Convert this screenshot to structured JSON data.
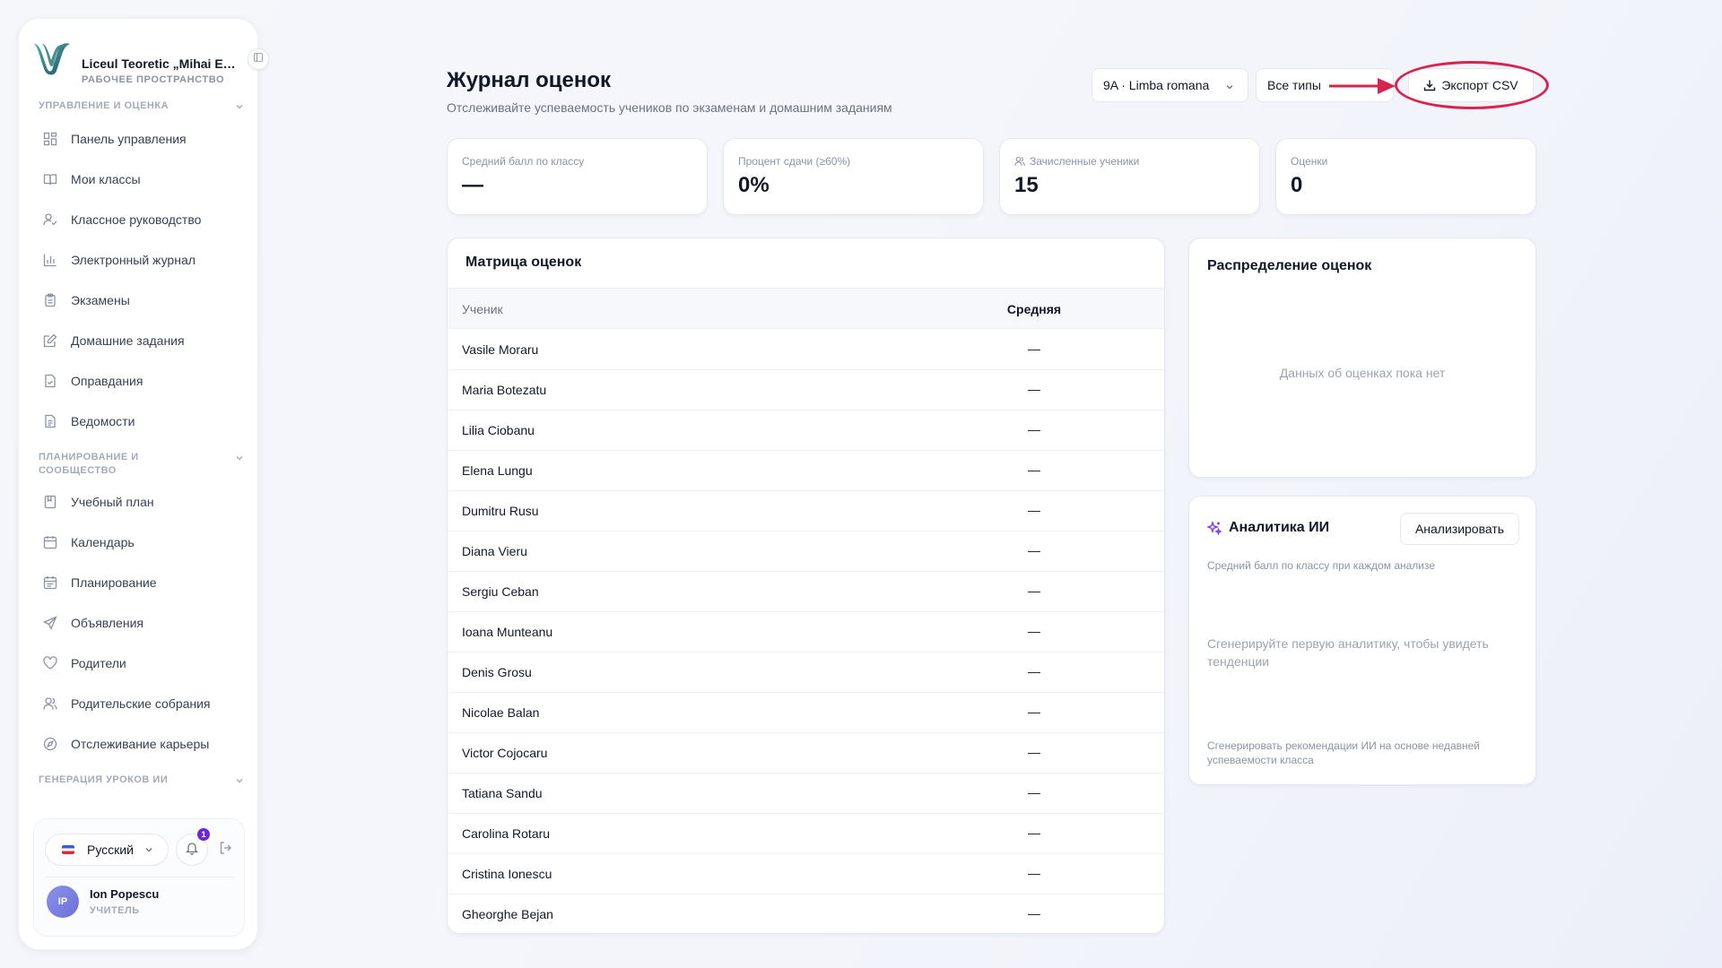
{
  "sidebar": {
    "brand_name": "Liceul Teoretic „Mihai Eminescu”",
    "brand_sub": "РАБОЧЕЕ ПРОСТРАНСТВО",
    "sections": [
      {
        "label": "УПРАВЛЕНИЕ И ОЦЕНКА"
      },
      {
        "label": "ПЛАНИРОВАНИЕ И СООБЩЕСТВО"
      },
      {
        "label": "ГЕНЕРАЦИЯ УРОКОВ ИИ"
      }
    ],
    "items": [
      {
        "label": "Панель управления",
        "icon": "dashboard-icon"
      },
      {
        "label": "Мои классы",
        "icon": "book-open-icon"
      },
      {
        "label": "Классное руководство",
        "icon": "user-check-icon"
      },
      {
        "label": "Электронный журнал",
        "icon": "bar-chart-icon"
      },
      {
        "label": "Экзамены",
        "icon": "clipboard-icon"
      },
      {
        "label": "Домашние задания",
        "icon": "edit-note-icon"
      },
      {
        "label": "Оправдания",
        "icon": "file-check-icon"
      },
      {
        "label": "Ведомости",
        "icon": "file-text-icon"
      },
      {
        "label": "Учебный план",
        "icon": "notebook-icon"
      },
      {
        "label": "Календарь",
        "icon": "calendar-icon"
      },
      {
        "label": "Планирование",
        "icon": "calendar-list-icon"
      },
      {
        "label": "Объявления",
        "icon": "send-icon"
      },
      {
        "label": "Родители",
        "icon": "heart-icon"
      },
      {
        "label": "Родительские собрания",
        "icon": "users-icon"
      },
      {
        "label": "Отслеживание карьеры",
        "icon": "compass-icon"
      }
    ],
    "language": "Русский",
    "notifications_count": "1",
    "user": {
      "initials": "IP",
      "name": "Ion Popescu",
      "role": "УЧИТЕЛЬ"
    }
  },
  "header": {
    "title": "Журнал оценок",
    "subtitle": "Отслеживайте успеваемость учеников по экзаменам и домашним заданиям",
    "class_select": "9A · Limba romana",
    "type_select": "Все типы",
    "export_label": "Экспорт CSV"
  },
  "stats": [
    {
      "label": "Средний балл по классу",
      "value": "—"
    },
    {
      "label": "Процент сдачи (≥60%)",
      "value": "0%"
    },
    {
      "label": "Зачисленные ученики",
      "value": "15"
    },
    {
      "label": "Оценки",
      "value": "0"
    }
  ],
  "matrix": {
    "title": "Матрица оценок",
    "col_student": "Ученик",
    "col_average": "Средняя",
    "rows": [
      {
        "name": "Vasile Moraru",
        "avg": "—"
      },
      {
        "name": "Maria Botezatu",
        "avg": "—"
      },
      {
        "name": "Lilia Ciobanu",
        "avg": "—"
      },
      {
        "name": "Elena Lungu",
        "avg": "—"
      },
      {
        "name": "Dumitru Rusu",
        "avg": "—"
      },
      {
        "name": "Diana Vieru",
        "avg": "—"
      },
      {
        "name": "Sergiu Ceban",
        "avg": "—"
      },
      {
        "name": "Ioana Munteanu",
        "avg": "—"
      },
      {
        "name": "Denis Grosu",
        "avg": "—"
      },
      {
        "name": "Nicolae Balan",
        "avg": "—"
      },
      {
        "name": "Victor Cojocaru",
        "avg": "—"
      },
      {
        "name": "Tatiana Sandu",
        "avg": "—"
      },
      {
        "name": "Carolina Rotaru",
        "avg": "—"
      },
      {
        "name": "Cristina Ionescu",
        "avg": "—"
      },
      {
        "name": "Gheorghe Bejan",
        "avg": "—"
      }
    ]
  },
  "distribution": {
    "title": "Распределение оценок",
    "empty": "Данных об оценках пока нет"
  },
  "ai": {
    "title": "Аналитика ИИ",
    "button": "Анализировать",
    "subtitle": "Средний балл по классу при каждом анализе",
    "empty": "Сгенерируйте первую аналитику, чтобы увидеть тенденции",
    "footer": "Сгенерировать рекомендации ИИ на основе недавней успеваемости класса"
  },
  "colors": {
    "annotation": "#d6244f",
    "accent": "#6d28d9",
    "brand": "#2f7a73"
  }
}
